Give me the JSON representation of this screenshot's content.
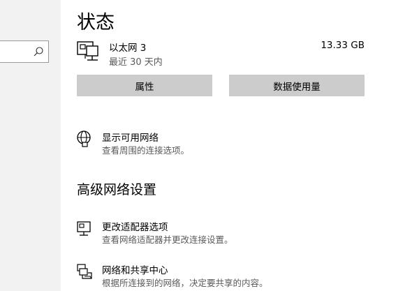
{
  "search": {
    "placeholder": ""
  },
  "page": {
    "title": "状态"
  },
  "network": {
    "name": "以太网 3",
    "period": "最近 30 天内",
    "usage": "13.33 GB"
  },
  "buttons": {
    "properties": "属性",
    "data_usage": "数据使用量"
  },
  "show_networks": {
    "title": "显示可用网络",
    "description": "查看周围的连接选项。"
  },
  "advanced": {
    "title": "高级网络设置",
    "items": [
      {
        "title": "更改适配器选项",
        "description": "查看网络适配器并更改连接设置。",
        "icon": "adapter-icon"
      },
      {
        "title": "网络和共享中心",
        "description": "根据所连接到的网络，决定要共享的内容。",
        "icon": "sharing-center-icon"
      }
    ]
  }
}
